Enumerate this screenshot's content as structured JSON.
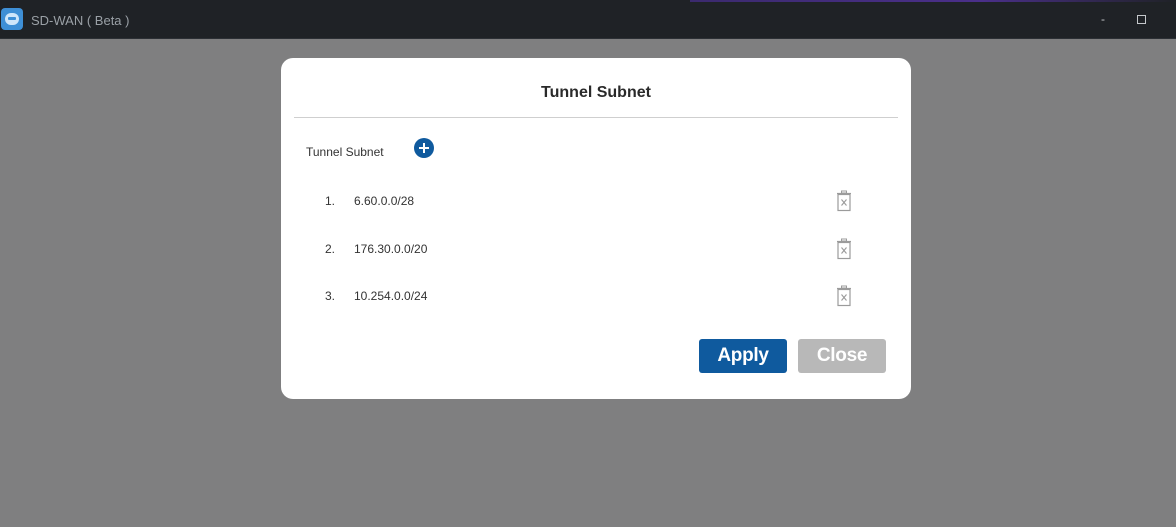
{
  "window": {
    "title": "SD-WAN ( Beta )",
    "minimize_label": "-",
    "app_icon": "sd-wan-app-icon"
  },
  "dialog": {
    "title": "Tunnel Subnet",
    "section_label": "Tunnel Subnet",
    "add_icon": "plus-circle-icon",
    "delete_icon": "trash-icon",
    "rows": [
      {
        "index": "1.",
        "subnet": "6.60.0.0/28"
      },
      {
        "index": "2.",
        "subnet": "176.30.0.0/20"
      },
      {
        "index": "3.",
        "subnet": "10.254.0.0/24"
      }
    ],
    "apply_label": "Apply",
    "close_label": "Close"
  },
  "colors": {
    "primary": "#0f5a9e",
    "disabled": "#b8b8b8",
    "backdrop": "#7f7f80",
    "titlebar": "#1f2226"
  }
}
